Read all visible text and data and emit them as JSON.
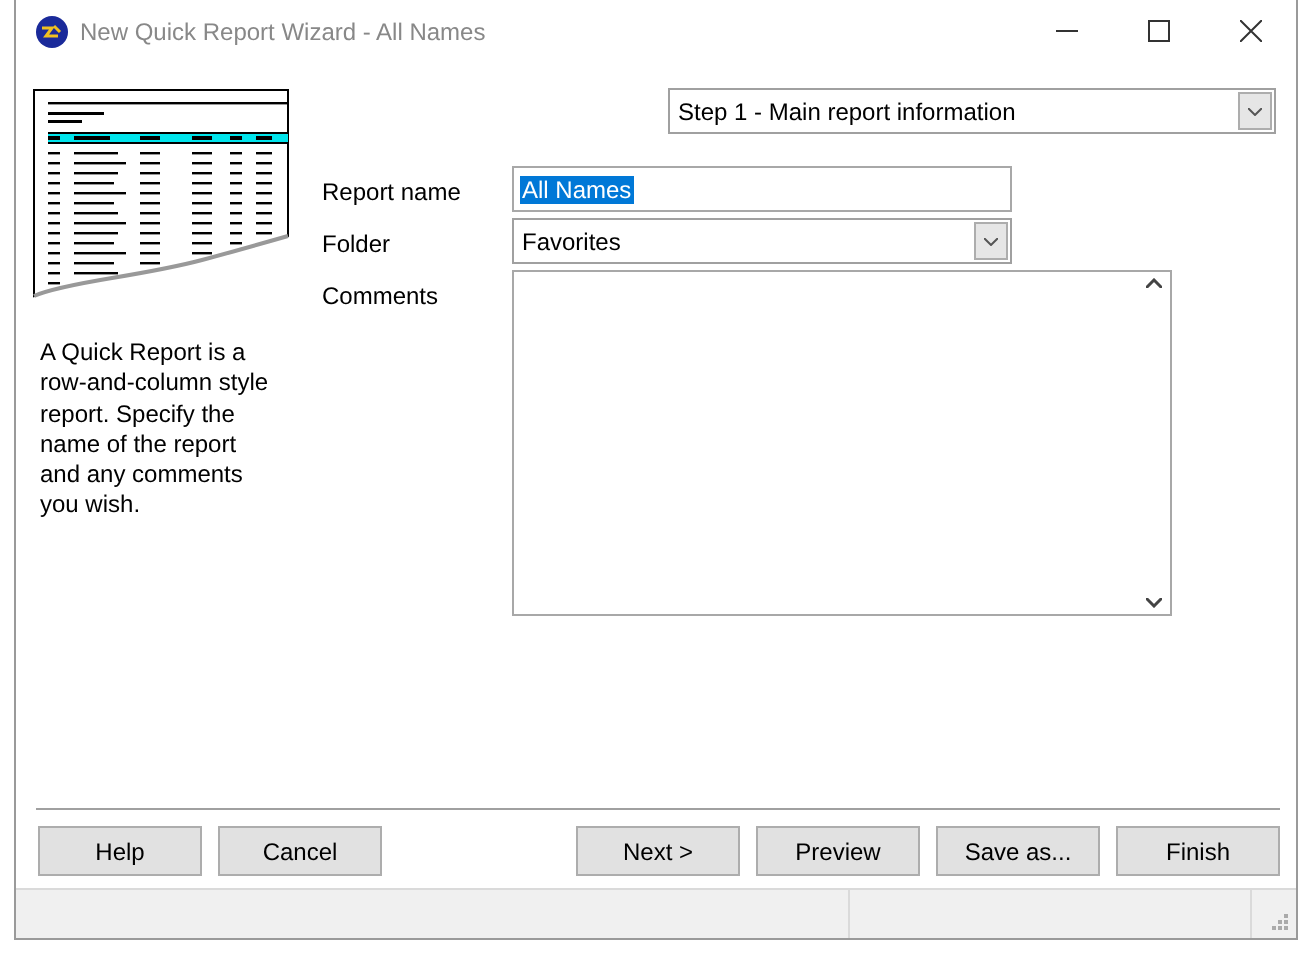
{
  "window": {
    "title": "New Quick Report Wizard - All Names"
  },
  "step_selector": {
    "value": "Step 1 - Main report information"
  },
  "description": "A Quick Report is a row-and-column style report. Specify the name of the report and any comments you wish.",
  "fields": [
    {
      "kind": "text",
      "label": "Report name",
      "value": "All Names",
      "selected": true
    },
    {
      "kind": "dropdown",
      "label": "Folder",
      "value": "Favorites"
    },
    {
      "kind": "memo",
      "label": "Comments"
    }
  ],
  "buttons_left": [
    "Help",
    "Cancel"
  ],
  "buttons_right": [
    "Next >",
    "Preview",
    "Save as...",
    "Finish"
  ]
}
